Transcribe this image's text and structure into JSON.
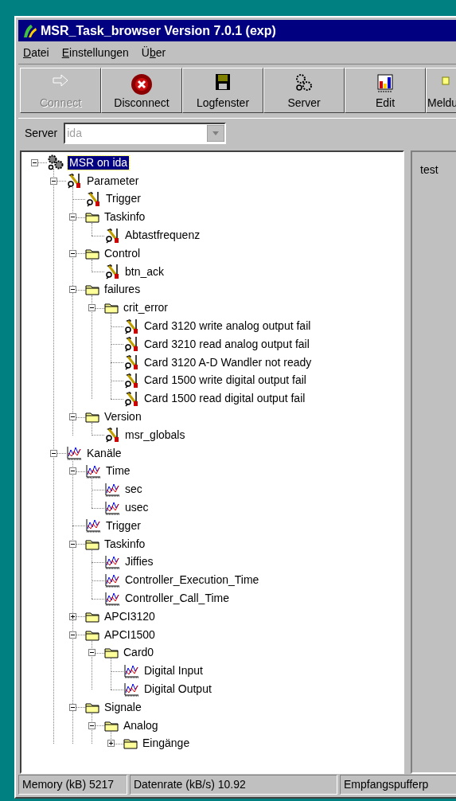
{
  "window": {
    "title": "MSR_Task_browser Version 7.0.1 (exp)"
  },
  "menu": [
    {
      "key": "D",
      "post": "atei"
    },
    {
      "key": "E",
      "post": "instellungen"
    },
    {
      "pre": "Ü",
      "key": "b",
      "post": "er"
    }
  ],
  "toolbar": [
    {
      "label": "Connect",
      "kind": "arrow",
      "disabled": true
    },
    {
      "label": "Disconnect",
      "kind": "stop",
      "disabled": false
    },
    {
      "label": "Logfenster",
      "kind": "disk",
      "disabled": false
    },
    {
      "label": "Server",
      "kind": "gears",
      "disabled": false
    },
    {
      "label": "Edit",
      "kind": "bars",
      "disabled": false
    },
    {
      "label": "Meldu",
      "kind": "note",
      "disabled": false
    }
  ],
  "server": {
    "label": "Server",
    "value": "ida",
    "disabled": true
  },
  "tree": [
    {
      "label": "MSR on ida",
      "kind": "root",
      "expanded": true,
      "selected": true,
      "children": [
        {
          "label": "Parameter",
          "kind": "param",
          "expanded": true,
          "selected": false,
          "children": [
            {
              "label": "Trigger",
              "kind": "param",
              "selected": false
            },
            {
              "label": "Taskinfo",
              "kind": "folder",
              "expanded": true,
              "selected": false,
              "children": [
                {
                  "label": "Abtastfrequenz",
                  "kind": "param",
                  "selected": false
                }
              ]
            },
            {
              "label": "Control",
              "kind": "folder",
              "expanded": true,
              "selected": false,
              "children": [
                {
                  "label": "btn_ack",
                  "kind": "param",
                  "selected": false
                }
              ]
            },
            {
              "label": "failures",
              "kind": "folder",
              "expanded": true,
              "selected": false,
              "children": [
                {
                  "label": "crit_error",
                  "kind": "folder",
                  "expanded": true,
                  "selected": false,
                  "children": [
                    {
                      "label": "Card 3120 write analog output fail",
                      "kind": "param",
                      "selected": false
                    },
                    {
                      "label": "Card 3210 read analog output fail",
                      "kind": "param",
                      "selected": false
                    },
                    {
                      "label": "Card 3120 A-D Wandler not ready",
                      "kind": "param",
                      "selected": false
                    },
                    {
                      "label": "Card 1500 write digital output fail",
                      "kind": "param",
                      "selected": false
                    },
                    {
                      "label": "Card 1500 read digital output fail",
                      "kind": "param",
                      "selected": false
                    }
                  ]
                }
              ]
            },
            {
              "label": "Version",
              "kind": "folder",
              "expanded": true,
              "selected": false,
              "children": [
                {
                  "label": "msr_globals",
                  "kind": "param",
                  "selected": false
                }
              ]
            }
          ]
        },
        {
          "label": "Kanäle",
          "kind": "chart",
          "expanded": true,
          "selected": false,
          "children": [
            {
              "label": "Time",
              "kind": "chart",
              "expanded": true,
              "selected": false,
              "children": [
                {
                  "label": "sec",
                  "kind": "chart",
                  "selected": false
                },
                {
                  "label": "usec",
                  "kind": "chart",
                  "selected": false
                }
              ]
            },
            {
              "label": "Trigger",
              "kind": "chart",
              "selected": false
            },
            {
              "label": "Taskinfo",
              "kind": "folder",
              "expanded": true,
              "selected": false,
              "children": [
                {
                  "label": "Jiffies",
                  "kind": "chart",
                  "selected": false
                },
                {
                  "label": "Controller_Execution_Time",
                  "kind": "chart",
                  "selected": false
                },
                {
                  "label": "Controller_Call_Time",
                  "kind": "chart",
                  "selected": false
                }
              ]
            },
            {
              "label": "APCI3120",
              "kind": "folder",
              "expanded": false,
              "selected": false
            },
            {
              "label": "APCI1500",
              "kind": "folder",
              "expanded": true,
              "selected": false,
              "children": [
                {
                  "label": "Card0",
                  "kind": "folder",
                  "expanded": true,
                  "selected": false,
                  "children": [
                    {
                      "label": "Digital Input",
                      "kind": "chart",
                      "selected": false
                    },
                    {
                      "label": "Digital Output",
                      "kind": "chart",
                      "selected": false
                    }
                  ]
                }
              ]
            },
            {
              "label": "Signale",
              "kind": "folder",
              "expanded": true,
              "selected": false,
              "children": [
                {
                  "label": "Analog",
                  "kind": "folder",
                  "expanded": true,
                  "selected": false,
                  "children": [
                    {
                      "label": "Eingänge",
                      "kind": "folder",
                      "expanded": false,
                      "selected": false
                    }
                  ]
                }
              ]
            }
          ]
        }
      ]
    }
  ],
  "detail": {
    "text": "test"
  },
  "status_bar": [
    "Memory (kB) 5217",
    "Datenrate (kB/s) 10.92",
    "Empfangspufferp"
  ]
}
